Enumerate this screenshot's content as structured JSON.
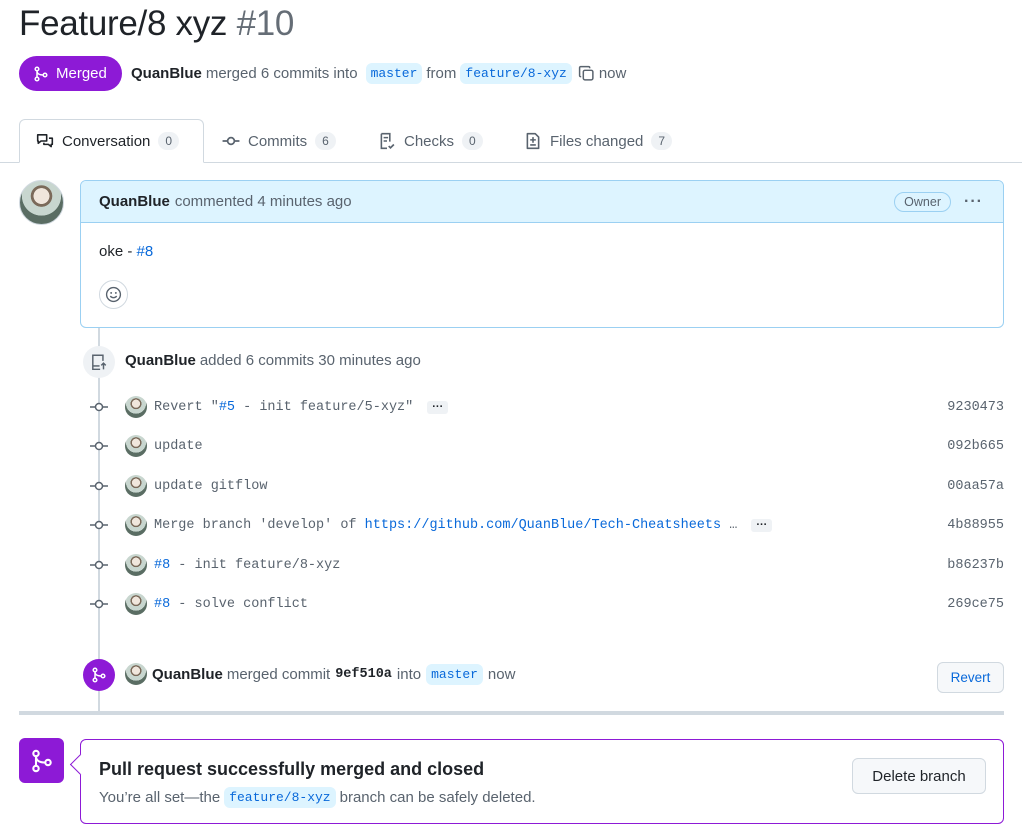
{
  "pr": {
    "title": "Feature/8 xyz",
    "number": "#10",
    "state": "Merged",
    "author": "QuanBlue",
    "action": "merged 6 commits into",
    "base_branch": "master",
    "from_text": "from",
    "head_branch": "feature/8-xyz",
    "time": "now"
  },
  "tabs": [
    {
      "label": "Conversation",
      "count": "0",
      "icon": "comment-discussion-icon"
    },
    {
      "label": "Commits",
      "count": "6",
      "icon": "git-commit-icon"
    },
    {
      "label": "Checks",
      "count": "0",
      "icon": "checklist-icon"
    },
    {
      "label": "Files changed",
      "count": "7",
      "icon": "file-diff-icon"
    }
  ],
  "comment": {
    "author": "QuanBlue",
    "meta": "commented 4 minutes ago",
    "role_badge": "Owner",
    "body_text": "oke - ",
    "body_link": "#8"
  },
  "added_event": {
    "author": "QuanBlue",
    "text": "added 6 commits 30 minutes ago"
  },
  "commits": [
    {
      "pre": "Revert \"",
      "link": "#5",
      "post": " - init feature/5-xyz\"",
      "sha": "9230473",
      "more": "···"
    },
    {
      "pre": "update",
      "link": "",
      "post": "",
      "sha": "092b665",
      "more": ""
    },
    {
      "pre": "update gitflow",
      "link": "",
      "post": "",
      "sha": "00aa57a",
      "more": ""
    },
    {
      "pre": "Merge branch 'develop' of ",
      "link": "https://github.com/QuanBlue/Tech-Cheatsheets",
      "post": " …",
      "sha": "4b88955",
      "more": "···"
    },
    {
      "pre": "",
      "link": "#8",
      "post": " - init feature/8-xyz",
      "sha": "b86237b",
      "more": ""
    },
    {
      "pre": "",
      "link": "#8",
      "post": " - solve conflict",
      "sha": "269ce75",
      "more": ""
    }
  ],
  "merged_event": {
    "author": "QuanBlue",
    "text": "merged commit",
    "sha": "9ef510a",
    "into": "into",
    "branch": "master",
    "time": "now",
    "revert_label": "Revert"
  },
  "merge_box": {
    "title": "Pull request successfully merged and closed",
    "sub_pre": "You’re all set—the",
    "branch": "feature/8-xyz",
    "sub_post": "branch can be safely deleted.",
    "delete_label": "Delete branch"
  },
  "colors": {
    "merged_purple": "#8d1ad6",
    "link_blue": "#0969da",
    "comment_header_bg": "#ddf4ff"
  }
}
